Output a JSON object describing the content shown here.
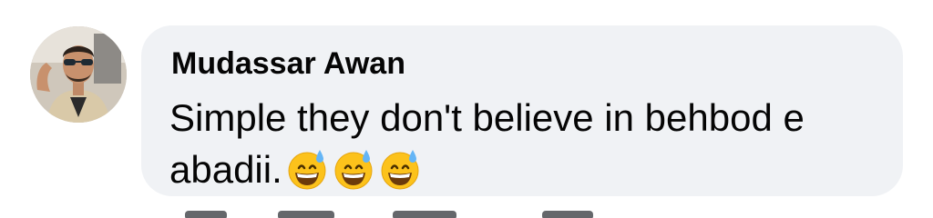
{
  "comment": {
    "author": "Mudassar Awan",
    "text": "Simple they don't believe in behbod e abadii.",
    "emojis": [
      "grinning-face-with-sweat-icon",
      "grinning-face-with-sweat-icon",
      "grinning-face-with-sweat-icon"
    ]
  },
  "colors": {
    "bubble_background": "#f0f2f5",
    "text": "#050505",
    "secondary_text": "#65676b"
  }
}
